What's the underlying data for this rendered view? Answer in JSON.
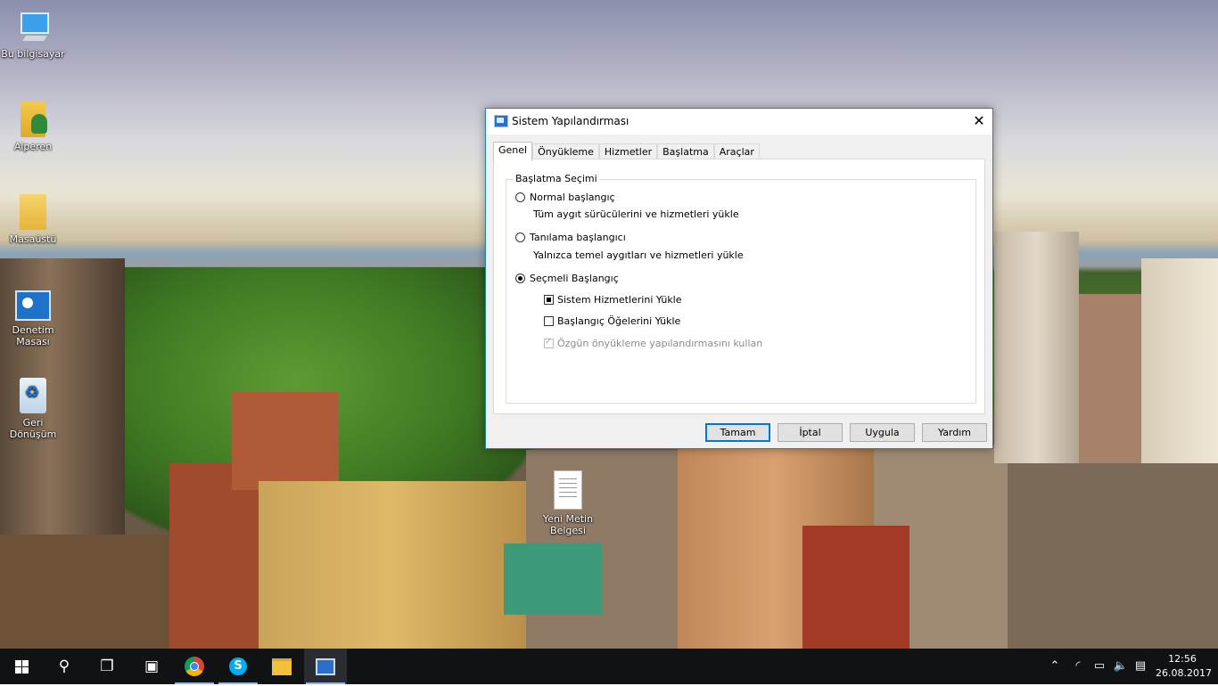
{
  "desktop": {
    "icons": [
      {
        "label": "Bu bilgisayar",
        "icon": "computer-icon"
      },
      {
        "label": "Alperen",
        "icon": "user-folder-icon"
      },
      {
        "label": "Masaüstü",
        "icon": "folder-icon"
      },
      {
        "label": "Denetim Masası",
        "icon": "control-panel-icon"
      },
      {
        "label": "Geri Dönüşüm",
        "icon": "recycle-bin-icon"
      },
      {
        "label": "Yeni Metin Belgesi",
        "icon": "text-document-icon"
      }
    ]
  },
  "dialog": {
    "title": "Sistem Yapılandırması",
    "close": "✕",
    "tabs": [
      {
        "label": "Genel",
        "active": true
      },
      {
        "label": "Önyükleme"
      },
      {
        "label": "Hizmetler"
      },
      {
        "label": "Başlatma"
      },
      {
        "label": "Araçlar"
      }
    ],
    "group_title": "Başlatma Seçimi",
    "options": {
      "normal": {
        "label": "Normal başlangıç",
        "description": "Tüm aygıt sürücülerini ve hizmetleri yükle",
        "selected": false
      },
      "diagnostic": {
        "label": "Tanılama başlangıcı",
        "description": "Yalnızca temel aygıtları ve hizmetleri yükle",
        "selected": false
      },
      "selective": {
        "label": "Seçmeli Başlangıç",
        "selected": true
      }
    },
    "checkboxes": {
      "services": {
        "label": "Sistem Hizmetlerini Yükle",
        "state": "indeterminate"
      },
      "startup": {
        "label": "Başlangıç Öğelerini Yükle",
        "state": "unchecked"
      },
      "original_boot": {
        "label": "Özgün önyükleme yapılandırmasını kullan",
        "state": "checked-disabled"
      }
    },
    "buttons": {
      "ok": "Tamam",
      "cancel": "İptal",
      "apply": "Uygula",
      "help": "Yardım"
    }
  },
  "taskbar": {
    "apps": [
      {
        "name": "start-button",
        "icon": "windows-logo-icon"
      },
      {
        "name": "search-button",
        "icon": "search-icon"
      },
      {
        "name": "task-view-button",
        "icon": "task-view-icon"
      },
      {
        "name": "photos-app",
        "icon": "photos-icon"
      },
      {
        "name": "chrome-app",
        "icon": "chrome-icon"
      },
      {
        "name": "skype-app",
        "icon": "skype-icon"
      },
      {
        "name": "file-explorer-app",
        "icon": "folder-icon"
      },
      {
        "name": "msconfig-app",
        "icon": "msconfig-icon"
      }
    ],
    "clock": {
      "time": "12:56",
      "date": "26.08.2017"
    }
  }
}
